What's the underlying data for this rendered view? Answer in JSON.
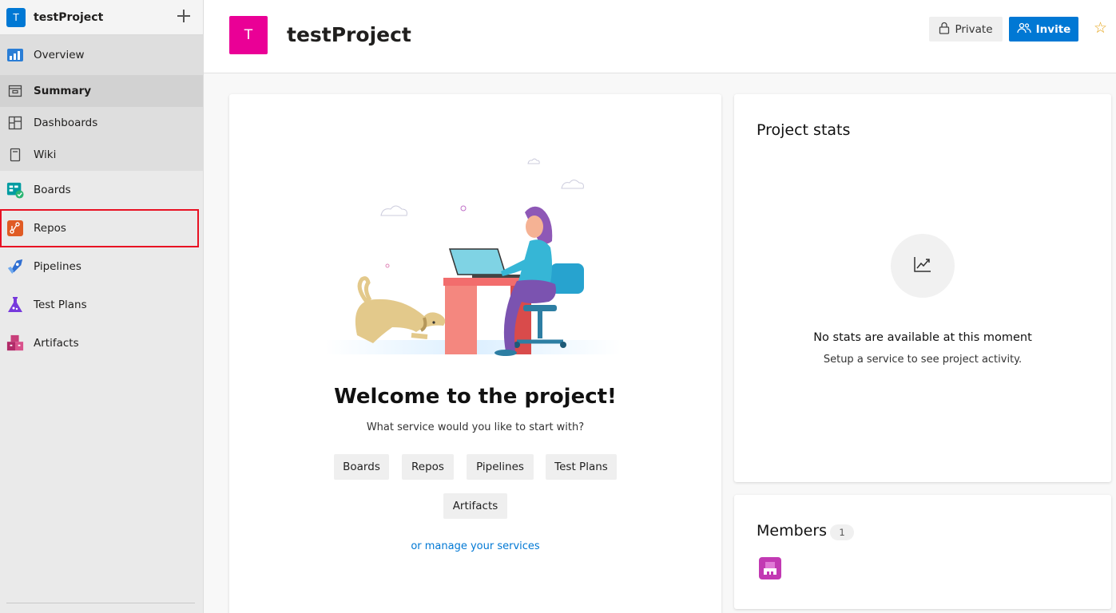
{
  "sidebar": {
    "project_initial": "T",
    "project_name": "testProject",
    "items": [
      {
        "label": "Overview",
        "icon": "overview-icon"
      },
      {
        "label": "Summary",
        "icon": "summary-icon"
      },
      {
        "label": "Dashboards",
        "icon": "dashboards-icon"
      },
      {
        "label": "Wiki",
        "icon": "wiki-icon"
      },
      {
        "label": "Boards",
        "icon": "boards-icon"
      },
      {
        "label": "Repos",
        "icon": "repos-icon"
      },
      {
        "label": "Pipelines",
        "icon": "pipelines-icon"
      },
      {
        "label": "Test Plans",
        "icon": "test-plans-icon"
      },
      {
        "label": "Artifacts",
        "icon": "artifacts-icon"
      }
    ]
  },
  "header": {
    "avatar_initial": "T",
    "title": "testProject",
    "private_label": "Private",
    "invite_label": "Invite",
    "star": "☆"
  },
  "welcome": {
    "title": "Welcome to the project!",
    "subtitle": "What service would you like to start with?",
    "services": [
      "Boards",
      "Repos",
      "Pipelines",
      "Test Plans",
      "Artifacts"
    ],
    "manage_link": "or manage your services"
  },
  "stats": {
    "title": "Project stats",
    "empty_title": "No stats are available at this moment",
    "empty_sub": "Setup a service to see project activity."
  },
  "members": {
    "title": "Members",
    "count": "1"
  },
  "colors": {
    "accent": "#0078d4",
    "project_avatar": "#ea0096",
    "highlight": "#e81123"
  }
}
